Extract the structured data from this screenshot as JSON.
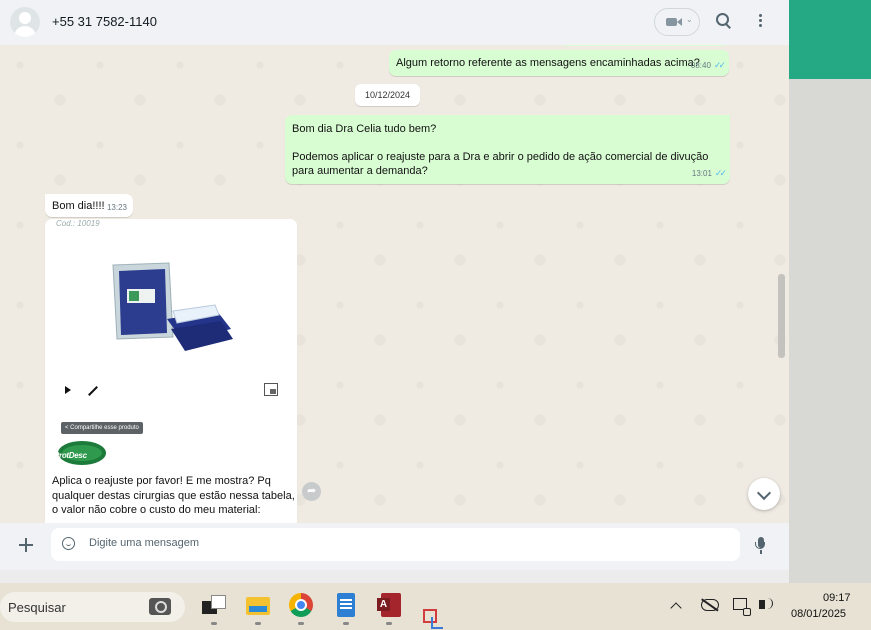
{
  "header": {
    "contact_name": "+55 31 7582-1140"
  },
  "messages": [
    {
      "direction": "outgoing",
      "text": "Algum retorno referente as mensagens encaminhadas acima?",
      "time": "08:40",
      "status": "read"
    },
    {
      "direction": "outgoing",
      "text_line1": "Bom dia Dra Celia tudo bem?",
      "text_line2": "Podemos aplicar o reajuste para a Dra e abrir o pedido de ação comercial de divução para aumentar a demanda?",
      "time": "13:01",
      "status": "read"
    },
    {
      "direction": "incoming",
      "text": "Bom dia!!!!",
      "time": "13:23"
    },
    {
      "direction": "incoming",
      "cod_label": "Cod.: 10019",
      "share_label": "Compartilhe esse produto",
      "logo_text": "ProtDesc",
      "caption": "Aplica o reajuste por favor! E me mostra? Pq qualquer destas cirurgias que estão nessa tabela, o valor não cobre o custo do meu material:"
    }
  ],
  "date_separator": "10/12/2024",
  "composer": {
    "placeholder": "Digite uma mensagem"
  },
  "taskbar": {
    "search_label": "Pesquisar",
    "time": "09:17",
    "date": "08/01/2025"
  },
  "colors": {
    "accent_green": "#25a884",
    "outgoing_bubble": "#d9fdd3",
    "incoming_bubble": "#ffffff",
    "read_ticks": "#53bdeb"
  }
}
